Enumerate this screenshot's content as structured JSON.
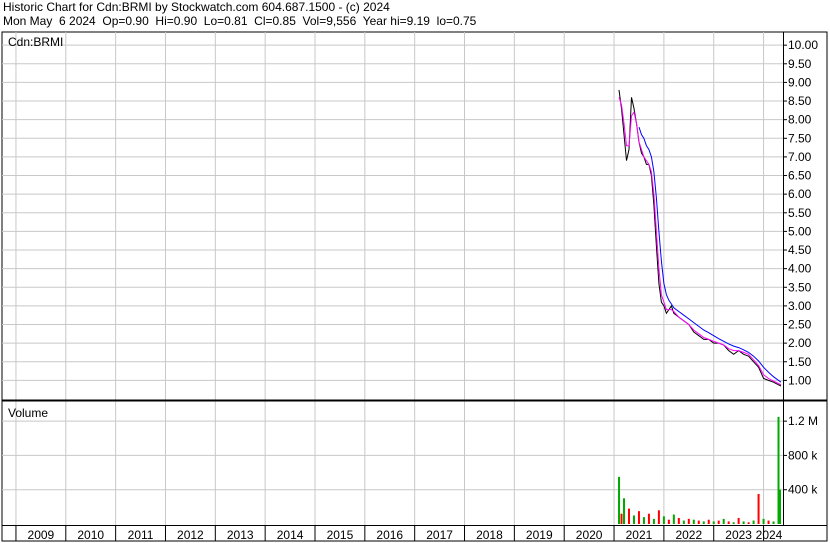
{
  "header": {
    "line1": "Historic Chart for Cdn:BRMI by Stockwatch.com 604.687.1500 - (c) 2024",
    "line2": "Mon May  6 2024  Op=0.90  Hi=0.90  Lo=0.81  Cl=0.85  Vol=9,556  Year hi=9.19  lo=0.75"
  },
  "chart_data": [
    {
      "type": "line",
      "panel": "price",
      "label": "Cdn:BRMI",
      "ylim": [
        0.5,
        10.3
      ],
      "y_ticks": [
        "1.00",
        "1.50",
        "2.00",
        "2.50",
        "3.00",
        "3.50",
        "4.00",
        "4.50",
        "5.00",
        "5.50",
        "6.00",
        "6.50",
        "7.00",
        "7.50",
        "8.00",
        "8.50",
        "9.00",
        "9.50",
        "10.00"
      ],
      "grid": true,
      "x": [
        2021.1,
        2021.15,
        2021.2,
        2021.25,
        2021.3,
        2021.35,
        2021.4,
        2021.45,
        2021.5,
        2021.55,
        2021.6,
        2021.65,
        2021.7,
        2021.75,
        2021.8,
        2021.85,
        2021.9,
        2021.95,
        2022.0,
        2022.05,
        2022.1,
        2022.15,
        2022.2,
        2022.3,
        2022.4,
        2022.5,
        2022.6,
        2022.7,
        2022.8,
        2022.9,
        2023.0,
        2023.1,
        2023.2,
        2023.3,
        2023.4,
        2023.5,
        2023.6,
        2023.7,
        2023.8,
        2023.9,
        2024.0,
        2024.1,
        2024.2,
        2024.3,
        2024.35
      ],
      "series": [
        {
          "color": "#000000",
          "values": [
            8.8,
            8.3,
            7.6,
            6.9,
            7.2,
            8.6,
            8.3,
            7.9,
            7.4,
            7.1,
            7.0,
            6.8,
            6.8,
            6.5,
            5.7,
            4.6,
            3.6,
            3.1,
            3.0,
            2.8,
            2.9,
            3.0,
            2.8,
            2.7,
            2.6,
            2.5,
            2.3,
            2.2,
            2.1,
            2.1,
            2.0,
            2.0,
            1.95,
            1.8,
            1.7,
            1.8,
            1.7,
            1.65,
            1.5,
            1.35,
            1.05,
            1.0,
            0.95,
            0.88,
            0.85
          ]
        },
        {
          "color": "#ff00ff",
          "values": [
            8.6,
            8.4,
            7.9,
            7.3,
            7.3,
            8.1,
            8.2,
            7.9,
            7.4,
            7.2,
            7.0,
            6.9,
            6.8,
            6.6,
            6.0,
            5.0,
            4.0,
            3.3,
            3.1,
            2.9,
            2.9,
            2.9,
            2.85,
            2.7,
            2.6,
            2.5,
            2.35,
            2.25,
            2.15,
            2.1,
            2.05,
            2.0,
            1.95,
            1.85,
            1.8,
            1.8,
            1.75,
            1.7,
            1.55,
            1.4,
            1.15,
            1.05,
            0.98,
            0.92,
            0.88
          ]
        },
        {
          "color": "#0000ff",
          "values": [
            null,
            null,
            null,
            null,
            null,
            null,
            null,
            null,
            7.8,
            7.6,
            7.5,
            7.3,
            7.2,
            7.0,
            6.6,
            5.9,
            5.0,
            4.2,
            3.6,
            3.3,
            3.15,
            3.05,
            2.95,
            2.85,
            2.75,
            2.65,
            2.55,
            2.45,
            2.35,
            2.28,
            2.2,
            2.12,
            2.05,
            1.98,
            1.92,
            1.88,
            1.82,
            1.75,
            1.65,
            1.52,
            1.35,
            1.22,
            1.1,
            1.0,
            0.95
          ]
        }
      ]
    },
    {
      "type": "bar",
      "panel": "volume",
      "label": "Volume",
      "ylim": [
        0,
        1400000
      ],
      "y_ticks": [
        "400 k",
        "800 k",
        "1.2 M"
      ],
      "grid": true,
      "x": [
        2021.1,
        2021.15,
        2021.2,
        2021.3,
        2021.4,
        2021.5,
        2021.6,
        2021.7,
        2021.8,
        2021.9,
        2022.0,
        2022.1,
        2022.2,
        2022.3,
        2022.4,
        2022.5,
        2022.6,
        2022.7,
        2022.8,
        2022.9,
        2023.0,
        2023.1,
        2023.2,
        2023.3,
        2023.4,
        2023.5,
        2023.6,
        2023.7,
        2023.8,
        2023.9,
        2024.0,
        2024.1,
        2024.2,
        2024.3,
        2024.33
      ],
      "values": [
        550000,
        120000,
        300000,
        180000,
        100000,
        150000,
        80000,
        120000,
        60000,
        160000,
        90000,
        50000,
        110000,
        70000,
        40000,
        60000,
        50000,
        40000,
        30000,
        50000,
        30000,
        40000,
        60000,
        30000,
        20000,
        70000,
        30000,
        20000,
        40000,
        350000,
        60000,
        40000,
        30000,
        1250000,
        400000
      ],
      "colors": [
        "#00aa00",
        "#ff0000",
        "#00aa00",
        "#ff0000",
        "#00aa00",
        "#ff0000",
        "#00aa00",
        "#ff0000",
        "#00aa00",
        "#ff0000",
        "#00aa00",
        "#ff0000",
        "#00aa00",
        "#ff0000",
        "#00aa00",
        "#ff0000",
        "#00aa00",
        "#ff0000",
        "#00aa00",
        "#ff0000",
        "#00aa00",
        "#ff0000",
        "#00aa00",
        "#ff0000",
        "#00aa00",
        "#ff0000",
        "#00aa00",
        "#ff0000",
        "#00aa00",
        "#ff0000",
        "#00aa00",
        "#ff0000",
        "#00aa00",
        "#00aa00",
        "#00aa00"
      ]
    }
  ],
  "x_axis": {
    "labels": [
      "2009",
      "2010",
      "2011",
      "2012",
      "2013",
      "2014",
      "2015",
      "2016",
      "2017",
      "2018",
      "2019",
      "2020",
      "2021",
      "2022",
      "2023",
      "2024"
    ]
  }
}
